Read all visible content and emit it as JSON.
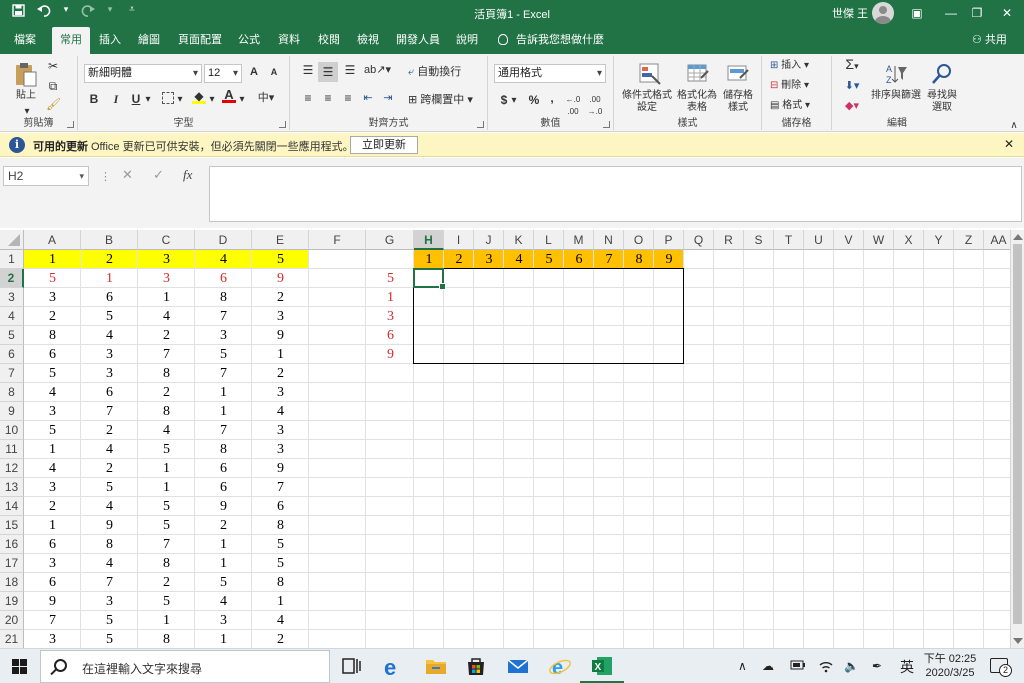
{
  "titlebar": {
    "doc_title": "活頁簿1 - Excel",
    "user_name": "世傑 王",
    "qat": {
      "save_icon": "save-icon",
      "undo_icon": "undo-icon",
      "redo_icon": "redo-icon",
      "customize_icon": "customize-qat-icon"
    },
    "window": {
      "ribbon_display": "▣",
      "minimize": "—",
      "restore": "❐",
      "close": "✕"
    }
  },
  "tabs": {
    "items": [
      "檔案",
      "常用",
      "插入",
      "繪圖",
      "頁面配置",
      "公式",
      "資料",
      "校閱",
      "檢視",
      "開發人員",
      "說明"
    ],
    "active": "常用",
    "tell_me": "告訴我您想做什麼",
    "share": "共用"
  },
  "ribbon": {
    "clipboard": {
      "label": "剪貼簿",
      "paste": "貼上"
    },
    "font": {
      "label": "字型",
      "font_name": "新細明體",
      "font_size": "12",
      "grow": "A",
      "shrink": "A",
      "bold": "B",
      "italic": "I",
      "underline": "U"
    },
    "alignment": {
      "label": "對齊方式",
      "wrap_text": "自動換行",
      "merge_center": "跨欄置中"
    },
    "number": {
      "label": "數值",
      "format": "通用格式",
      "currency": "$",
      "percent": "%",
      "comma": ","
    },
    "styles": {
      "label": "樣式",
      "conditional": "條件式格式\n設定",
      "table": "格式化為\n表格",
      "cell_styles": "儲存格\n樣式"
    },
    "cells": {
      "label": "儲存格",
      "insert": "插入",
      "delete": "刪除",
      "format": "格式"
    },
    "editing": {
      "label": "編輯",
      "sum": "Σ",
      "sort_filter": "排序與篩選",
      "find_select": "尋找與\n選取"
    }
  },
  "infobar": {
    "title": "可用的更新",
    "message": "Office 更新已可供安裝，但必須先關閉一些應用程式。",
    "button": "立即更新",
    "close": "✕"
  },
  "formula_bar": {
    "name_box": "H2",
    "fx": "fx",
    "cancel": "✕",
    "enter": "✓",
    "formula": ""
  },
  "grid": {
    "columns": [
      "A",
      "B",
      "C",
      "D",
      "E",
      "F",
      "G",
      "H",
      "I",
      "J",
      "K",
      "L",
      "M",
      "N",
      "O",
      "P",
      "Q",
      "R",
      "S",
      "T",
      "U",
      "V",
      "W",
      "X",
      "Y",
      "Z",
      "AA"
    ],
    "rows": [
      "1",
      "2",
      "3",
      "4",
      "5",
      "6",
      "7",
      "8",
      "9",
      "10",
      "11",
      "12",
      "13",
      "14",
      "15",
      "16",
      "17",
      "18",
      "19",
      "20",
      "21"
    ],
    "selected_cell": "H2",
    "data_a_to_e": [
      [
        "1",
        "2",
        "3",
        "4",
        "5"
      ],
      [
        "5",
        "1",
        "3",
        "6",
        "9"
      ],
      [
        "3",
        "6",
        "1",
        "8",
        "2"
      ],
      [
        "2",
        "5",
        "4",
        "7",
        "3"
      ],
      [
        "8",
        "4",
        "2",
        "3",
        "9"
      ],
      [
        "6",
        "3",
        "7",
        "5",
        "1"
      ],
      [
        "5",
        "3",
        "8",
        "7",
        "2"
      ],
      [
        "4",
        "6",
        "2",
        "1",
        "3"
      ],
      [
        "3",
        "7",
        "8",
        "1",
        "4"
      ],
      [
        "5",
        "2",
        "4",
        "7",
        "3"
      ],
      [
        "1",
        "4",
        "5",
        "8",
        "3"
      ],
      [
        "4",
        "2",
        "1",
        "6",
        "9"
      ],
      [
        "3",
        "5",
        "1",
        "6",
        "7"
      ],
      [
        "2",
        "4",
        "5",
        "9",
        "6"
      ],
      [
        "1",
        "9",
        "5",
        "2",
        "8"
      ],
      [
        "6",
        "8",
        "7",
        "1",
        "5"
      ],
      [
        "3",
        "4",
        "8",
        "1",
        "5"
      ],
      [
        "6",
        "7",
        "2",
        "5",
        "8"
      ],
      [
        "9",
        "3",
        "5",
        "4",
        "1"
      ],
      [
        "7",
        "5",
        "1",
        "3",
        "4"
      ],
      [
        "3",
        "5",
        "8",
        "1",
        "2"
      ]
    ],
    "g_column": [
      "5",
      "1",
      "3",
      "6",
      "9"
    ],
    "header_h_to_p": [
      "1",
      "2",
      "3",
      "4",
      "5",
      "6",
      "7",
      "8",
      "9"
    ],
    "colors": {
      "yellow_fill": "#ffff00",
      "orange_fill": "#ffc000",
      "red_text": "#d62b2b"
    }
  },
  "taskbar": {
    "search_placeholder": "在這裡輸入文字來搜尋",
    "ime": "英",
    "time": "下午 02:25",
    "date": "2020/3/25",
    "notifications": "2"
  }
}
